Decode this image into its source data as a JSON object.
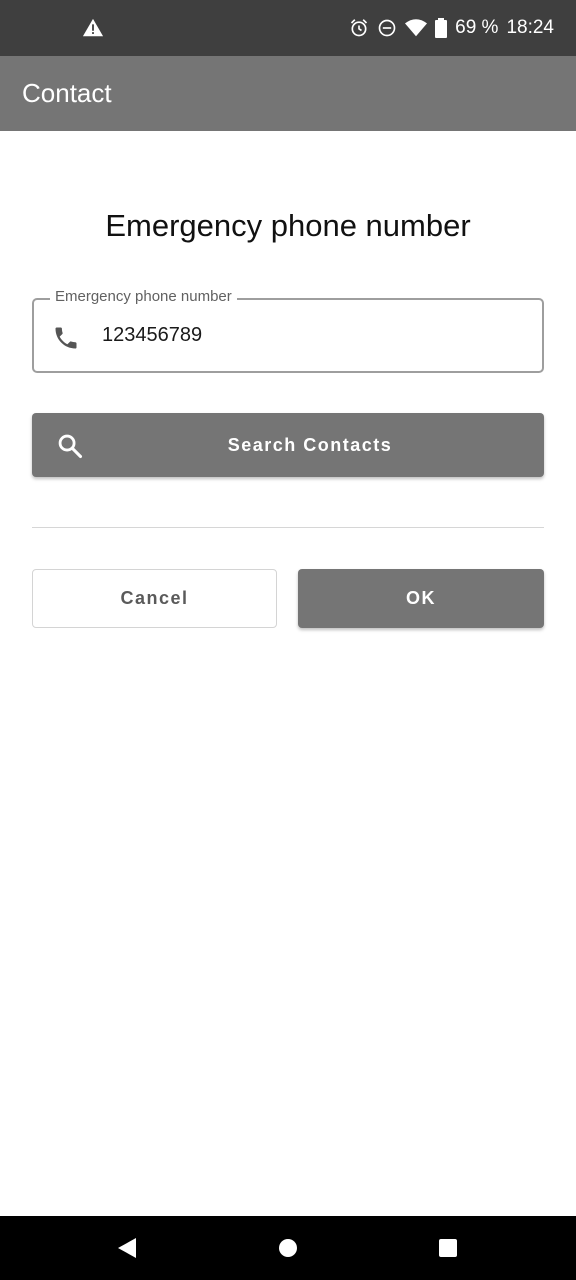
{
  "status_bar": {
    "battery": "69 %",
    "time": "18:24",
    "icons": [
      "warning-icon",
      "alarm-icon",
      "do-not-disturb-icon",
      "wifi-icon",
      "battery-icon"
    ]
  },
  "app_bar": {
    "title": "Contact"
  },
  "main": {
    "heading": "Emergency phone number",
    "phone_field": {
      "label": "Emergency phone number",
      "value": "123456789",
      "icon": "phone-icon"
    },
    "search_button": {
      "label": "Search Contacts",
      "icon": "search-icon"
    },
    "cancel_button": {
      "label": "Cancel"
    },
    "ok_button": {
      "label": "OK"
    }
  },
  "nav_bar": {
    "icons": [
      "back-icon",
      "home-icon",
      "recents-icon"
    ]
  },
  "colors": {
    "status_bar": "#3f3f3f",
    "app_bar": "#757575",
    "primary_button": "#757575",
    "nav_bar": "#000000"
  }
}
